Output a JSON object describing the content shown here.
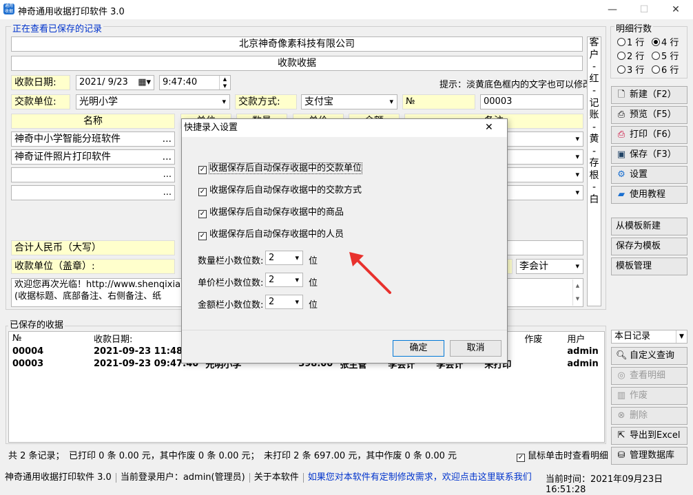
{
  "window": {
    "title": "神奇通用收据打印软件 3.0",
    "minimize": "—",
    "maximize": "☐",
    "close": "✕",
    "icon_text": "通用收据"
  },
  "viewing_link": "正在查看已保存的记录",
  "company": "北京神奇像素科技有限公司",
  "receipt_title": "收款收据",
  "date_label": "收款日期:",
  "date_value": "2021/ 9/23",
  "time_value": "9:47:40",
  "hint": "提示：淡黄底色框内的文字也可以修改",
  "payer_label": "交款单位:",
  "payer_value": "光明小学",
  "payment_label": "交款方式:",
  "payment_value": "支付宝",
  "no_label": "№",
  "no_value": "00003",
  "table_headers": {
    "name": "名称",
    "spec": "单位",
    "qty": "数量",
    "price": "单价",
    "amount": "金额",
    "note": "备注"
  },
  "items": [
    "神奇中小学智能分班软件",
    "神奇证件照片打印软件",
    "",
    ""
  ],
  "ellipsis": "...",
  "total_label": "合计人民币（大写）",
  "receiver_label": "收款单位（盖章）:",
  "accountant_value": "李会计",
  "footer_note_line1": "欢迎您再次光临！http://www.shenqixiangsu.com",
  "footer_note_line2": "(收据标题、底部备注、右侧备注、纸",
  "side_note": [
    "客",
    "户",
    "-",
    "红",
    "-",
    "记",
    "账",
    "-",
    "黄",
    "-",
    "存",
    "根",
    "-",
    "白"
  ],
  "rows_group": {
    "title": "明细行数",
    "options": [
      "1 行",
      "4 行",
      "2 行",
      "5 行",
      "3 行",
      "6 行"
    ],
    "selected": "4 行"
  },
  "buttons": {
    "new": "新建（F2）",
    "preview": "预览（F5）",
    "print": "打印（F6）",
    "save": "保存（F3）",
    "settings": "设置",
    "tutorial": "使用教程",
    "from_template": "从模板新建",
    "save_template": "保存为模板",
    "template_mgmt": "模板管理",
    "custom_query": "自定义查询",
    "view_detail": "查看明细",
    "void": "作废",
    "delete": "删除",
    "export_excel": "导出到Excel",
    "db_mgmt": "管理数据库"
  },
  "saved_section": "已保存的收据",
  "filter_value": "本日记录",
  "list_headers": {
    "no": "№",
    "date": "收款日期:",
    "void": "作废",
    "user": "用户"
  },
  "records": [
    {
      "no": "00004",
      "date": "2021-09-23 11:48:1",
      "payer": "",
      "amount": "",
      "handler": "",
      "acct": "",
      "status": "",
      "user": "admin"
    },
    {
      "no": "00003",
      "date": "2021-09-23 09:47:40",
      "payer": "光明小学",
      "amount": "398.00",
      "handler": "张主管",
      "acct": "李会计",
      "status2": "李会计",
      "status": "未打印",
      "user": "admin"
    }
  ],
  "summary": "共 2 条记录；　已打印 0 条 0.00 元，其中作废 0 条 0.00 元；　未打印 2 条 697.00 元，其中作废 0 条 0.00 元",
  "click_view_label": "鼠标单击时查看明细",
  "status": {
    "app": "神奇通用收据打印软件 3.0",
    "user": "当前登录用户：admin(管理员)",
    "about": "关于本软件",
    "contact": "如果您对本软件有定制修改需求，欢迎点击这里联系我们",
    "time": "当前时间：2021年09月23日　16:51:28"
  },
  "dialog": {
    "title": "快捷录入设置",
    "close": "✕",
    "options": [
      "收据保存后自动保存收据中的交款单位",
      "收据保存后自动保存收据中的交款方式",
      "收据保存后自动保存收据中的商品",
      "收据保存后自动保存收据中的人员"
    ],
    "qty_label": "数量栏小数位数:",
    "price_label": "单价栏小数位数:",
    "amount_label": "金额栏小数位数:",
    "qty_value": "2",
    "price_value": "2",
    "amount_value": "2",
    "unit": "位",
    "ok": "确定",
    "cancel": "取消"
  },
  "colors": {
    "accent": "#0033cc",
    "yellow": "#ffffcc",
    "arrow": "#e8312d"
  }
}
